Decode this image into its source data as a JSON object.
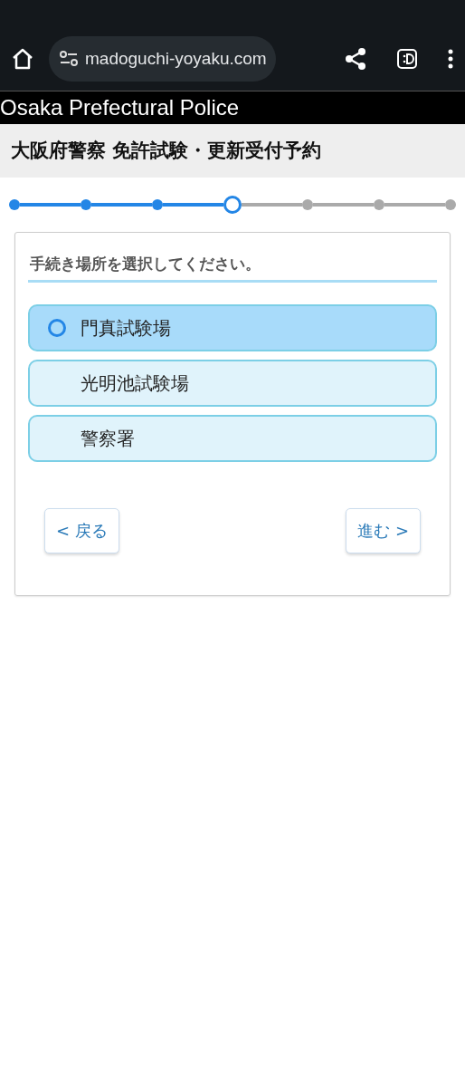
{
  "browser": {
    "url": "madoguchi-yoyaku.com"
  },
  "site_header": {
    "title": "Osaka Prefectural Police"
  },
  "page_title": "大阪府警察 免許試験・更新受付予約",
  "steps": [
    {
      "done": true,
      "selected": false
    },
    {
      "done": true,
      "selected": false
    },
    {
      "done": true,
      "selected": false
    },
    {
      "done": true,
      "selected": true
    },
    {
      "done": false,
      "selected": false
    },
    {
      "done": false,
      "selected": false
    },
    {
      "done": false,
      "selected": false
    }
  ],
  "card": {
    "heading": "手続き場所を選択してください。",
    "options": [
      {
        "label": "門真試験場",
        "selected": true
      },
      {
        "label": "光明池試験場",
        "selected": false
      },
      {
        "label": "警察署",
        "selected": false
      }
    ],
    "buttons": {
      "back": "< 戻る",
      "next": "進む >"
    }
  }
}
